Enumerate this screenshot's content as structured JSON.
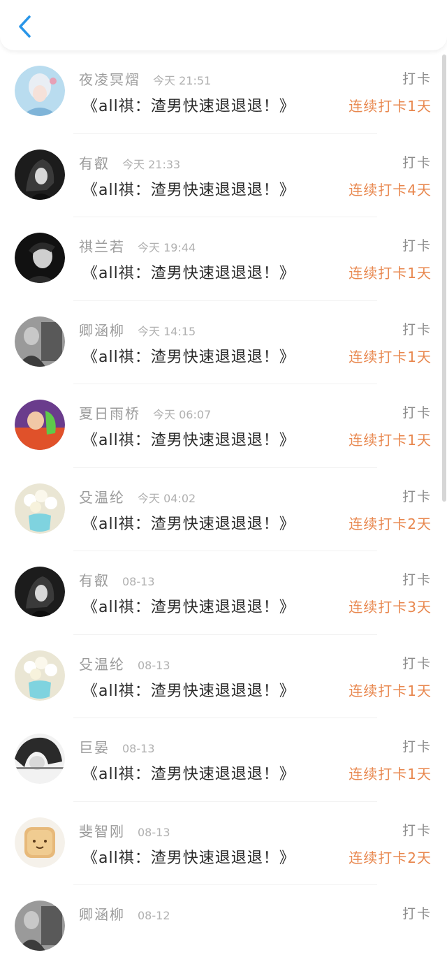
{
  "header": {
    "back_icon": "chevron-left-icon",
    "accent": "#2a96e8"
  },
  "colors": {
    "streak": "#e8874e"
  },
  "items": [
    {
      "name": "夜凌冥熠",
      "time": "今天 21:51",
      "title": "《all祺：渣男快速退退退！》",
      "tag": "打卡",
      "streak": "连续打卡1天"
    },
    {
      "name": "有叡",
      "time": "今天 21:33",
      "title": "《all祺：渣男快速退退退！》",
      "tag": "打卡",
      "streak": "连续打卡4天"
    },
    {
      "name": "祺兰若",
      "time": "今天 19:44",
      "title": "《all祺：渣男快速退退退！》",
      "tag": "打卡",
      "streak": "连续打卡1天"
    },
    {
      "name": "卿涵柳",
      "time": "今天 14:15",
      "title": "《all祺：渣男快速退退退！》",
      "tag": "打卡",
      "streak": "连续打卡1天"
    },
    {
      "name": "夏日雨桥",
      "time": "今天 06:07",
      "title": "《all祺：渣男快速退退退！》",
      "tag": "打卡",
      "streak": "连续打卡1天"
    },
    {
      "name": "殳温纶",
      "time": "今天 04:02",
      "title": "《all祺：渣男快速退退退！》",
      "tag": "打卡",
      "streak": "连续打卡2天"
    },
    {
      "name": "有叡",
      "time": "08-13",
      "title": "《all祺：渣男快速退退退！》",
      "tag": "打卡",
      "streak": "连续打卡3天"
    },
    {
      "name": "殳温纶",
      "time": "08-13",
      "title": "《all祺：渣男快速退退退！》",
      "tag": "打卡",
      "streak": "连续打卡1天"
    },
    {
      "name": "巨晏",
      "time": "08-13",
      "title": "《all祺：渣男快速退退退！》",
      "tag": "打卡",
      "streak": "连续打卡1天"
    },
    {
      "name": "斐智刚",
      "time": "08-13",
      "title": "《all祺：渣男快速退退退！》",
      "tag": "打卡",
      "streak": "连续打卡2天"
    },
    {
      "name": "卿涵柳",
      "time": "08-12",
      "title": "",
      "tag": "打卡",
      "streak": ""
    }
  ]
}
